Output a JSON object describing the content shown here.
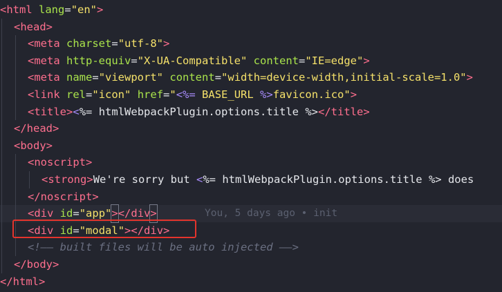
{
  "editor": {
    "lines": [
      {
        "tokens": [
          [
            "t",
            "<"
          ],
          [
            "t",
            "html"
          ],
          [
            "p",
            " "
          ],
          [
            "a",
            "lang"
          ],
          [
            "p",
            "="
          ],
          [
            "s",
            "\"en\""
          ],
          [
            "t",
            ">"
          ]
        ]
      },
      {
        "tokens": [
          [
            "t",
            "<"
          ],
          [
            "t",
            "head"
          ],
          [
            "t",
            ">"
          ]
        ]
      },
      {
        "tokens": [
          [
            "t",
            "<"
          ],
          [
            "t",
            "meta"
          ],
          [
            "p",
            " "
          ],
          [
            "a",
            "charset"
          ],
          [
            "p",
            "="
          ],
          [
            "s",
            "\"utf-8\""
          ],
          [
            "t",
            ">"
          ]
        ]
      },
      {
        "tokens": [
          [
            "t",
            "<"
          ],
          [
            "t",
            "meta"
          ],
          [
            "p",
            " "
          ],
          [
            "a",
            "http-equiv"
          ],
          [
            "p",
            "="
          ],
          [
            "s",
            "\"X-UA-Compatible\""
          ],
          [
            "p",
            " "
          ],
          [
            "a",
            "content"
          ],
          [
            "p",
            "="
          ],
          [
            "s",
            "\"IE=edge\""
          ],
          [
            "t",
            ">"
          ]
        ]
      },
      {
        "tokens": [
          [
            "t",
            "<"
          ],
          [
            "t",
            "meta"
          ],
          [
            "p",
            " "
          ],
          [
            "a",
            "name"
          ],
          [
            "p",
            "="
          ],
          [
            "s",
            "\"viewport\""
          ],
          [
            "p",
            " "
          ],
          [
            "a",
            "content"
          ],
          [
            "p",
            "="
          ],
          [
            "s",
            "\"width=device-width,initial-scale=1.0\""
          ],
          [
            "t",
            ">"
          ]
        ]
      },
      {
        "tokens": [
          [
            "t",
            "<"
          ],
          [
            "t",
            "link"
          ],
          [
            "p",
            " "
          ],
          [
            "a",
            "rel"
          ],
          [
            "p",
            "="
          ],
          [
            "s",
            "\"icon\""
          ],
          [
            "p",
            " "
          ],
          [
            "a",
            "href"
          ],
          [
            "p",
            "="
          ],
          [
            "s",
            "\""
          ],
          [
            "m",
            "<%="
          ],
          [
            "s",
            " BASE_URL "
          ],
          [
            "m",
            "%>"
          ],
          [
            "s",
            "favicon.ico\""
          ],
          [
            "t",
            ">"
          ]
        ]
      },
      {
        "tokens": [
          [
            "t",
            "<"
          ],
          [
            "t",
            "title"
          ],
          [
            "t",
            ">"
          ],
          [
            "m",
            "<"
          ],
          [
            "p",
            "%= htmlWebpackPlugin.options.title %>"
          ],
          [
            "t",
            "</"
          ],
          [
            "t",
            "title"
          ],
          [
            "t",
            ">"
          ]
        ]
      },
      {
        "tokens": [
          [
            "t",
            "</"
          ],
          [
            "t",
            "head"
          ],
          [
            "t",
            ">"
          ]
        ]
      },
      {
        "tokens": [
          [
            "t",
            "<"
          ],
          [
            "t",
            "body"
          ],
          [
            "t",
            ">"
          ]
        ]
      },
      {
        "tokens": [
          [
            "t",
            "<"
          ],
          [
            "t",
            "noscript"
          ],
          [
            "t",
            ">"
          ]
        ]
      },
      {
        "tokens": [
          [
            "t",
            "<"
          ],
          [
            "t",
            "strong"
          ],
          [
            "t",
            ">"
          ],
          [
            "p",
            "We're sorry but "
          ],
          [
            "m",
            "<"
          ],
          [
            "p",
            "%= htmlWebpackPlugin.options.title %> does"
          ]
        ]
      },
      {
        "tokens": [
          [
            "t",
            "</"
          ],
          [
            "t",
            "noscript"
          ],
          [
            "t",
            ">"
          ]
        ]
      },
      {
        "tokens": [
          [
            "t",
            "<"
          ],
          [
            "t",
            "div"
          ],
          [
            "p",
            " "
          ],
          [
            "a",
            "id"
          ],
          [
            "p",
            "="
          ],
          [
            "s",
            "\"app\""
          ],
          [
            "t",
            ">"
          ],
          [
            "t",
            "</"
          ],
          [
            "t",
            "div"
          ],
          [
            "t",
            ">"
          ]
        ]
      },
      {
        "tokens": [
          [
            "t",
            "<"
          ],
          [
            "t",
            "div"
          ],
          [
            "p",
            " "
          ],
          [
            "a",
            "id"
          ],
          [
            "p",
            "="
          ],
          [
            "s",
            "\"modal\""
          ],
          [
            "t",
            ">"
          ],
          [
            "t",
            "</"
          ],
          [
            "t",
            "div"
          ],
          [
            "t",
            ">"
          ]
        ]
      },
      {
        "tokens": [
          [
            "c",
            "<!—— built files will be auto injected ——>"
          ]
        ]
      },
      {
        "tokens": [
          [
            "t",
            "</"
          ],
          [
            "t",
            "body"
          ],
          [
            "t",
            ">"
          ]
        ]
      },
      {
        "tokens": [
          [
            "t",
            "</"
          ],
          [
            "t",
            "html"
          ],
          [
            "t",
            ">"
          ]
        ]
      }
    ],
    "blame": "You, 5 days ago • init",
    "highlighted_line": "<div id=\"modal\"></div>"
  }
}
